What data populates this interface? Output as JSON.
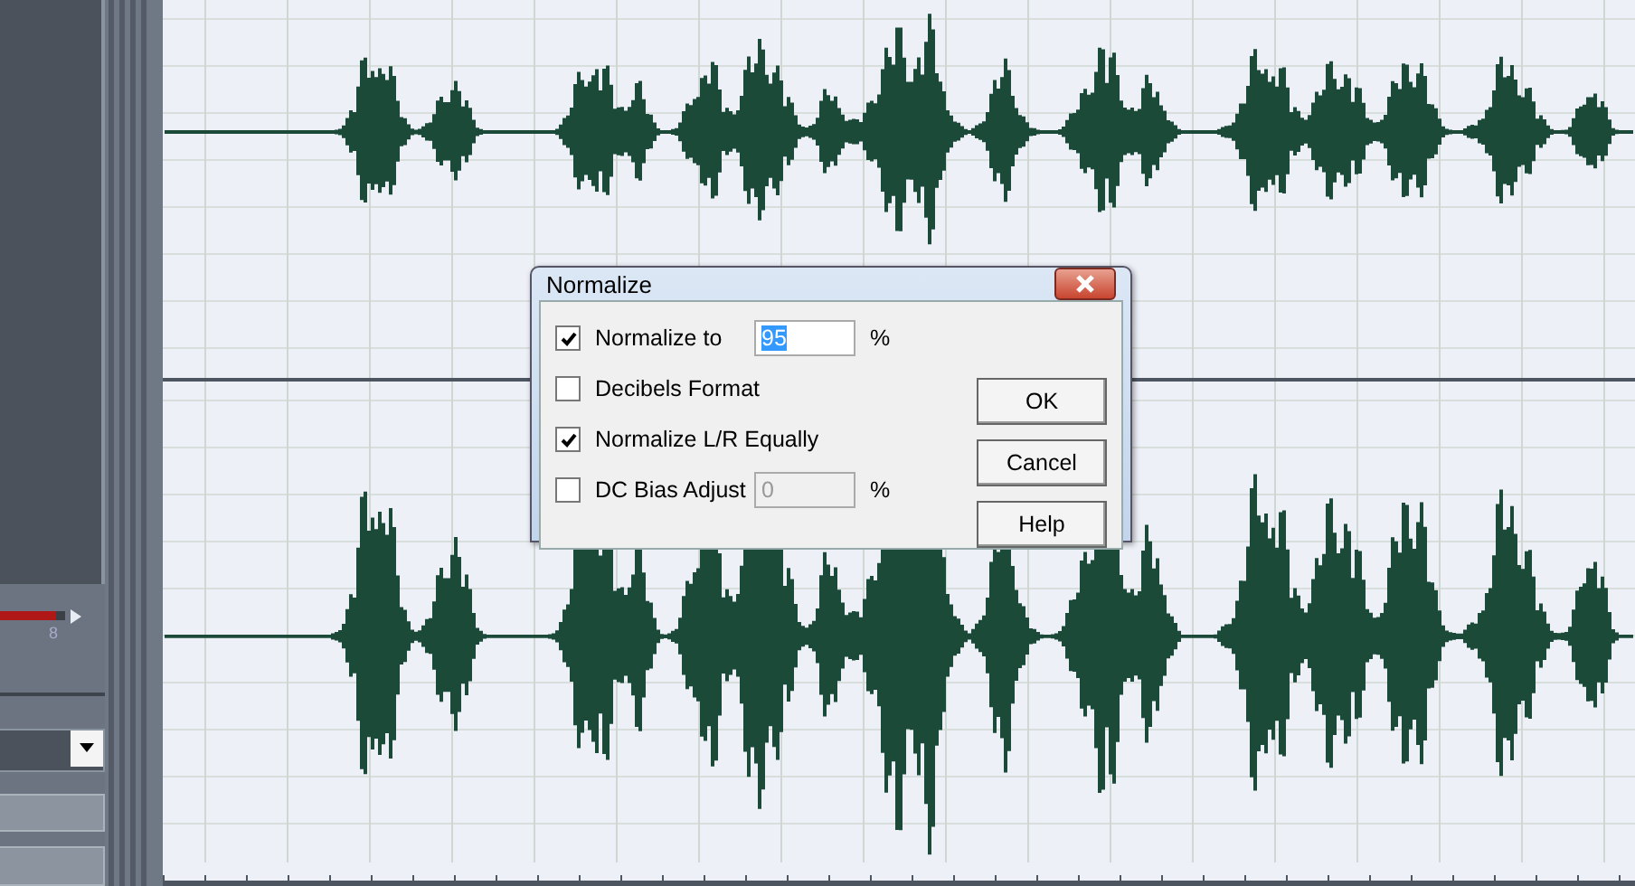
{
  "side_panel": {
    "meter": {
      "level": 0.85,
      "reading": "8"
    }
  },
  "dialog": {
    "title": "Normalize",
    "options": [
      {
        "kind": "check-field",
        "label": "Normalize to",
        "checked": true,
        "value": "95",
        "value_selected": true,
        "unit": "%",
        "disabled": false
      },
      {
        "kind": "check",
        "label": "Decibels Format",
        "checked": false
      },
      {
        "kind": "check",
        "label": "Normalize L/R Equally",
        "checked": true
      },
      {
        "kind": "check-field",
        "label": "DC Bias Adjust",
        "checked": false,
        "value": "0",
        "value_selected": false,
        "unit": "%",
        "disabled": true
      }
    ],
    "buttons": [
      "OK",
      "Cancel",
      "Help"
    ]
  }
}
